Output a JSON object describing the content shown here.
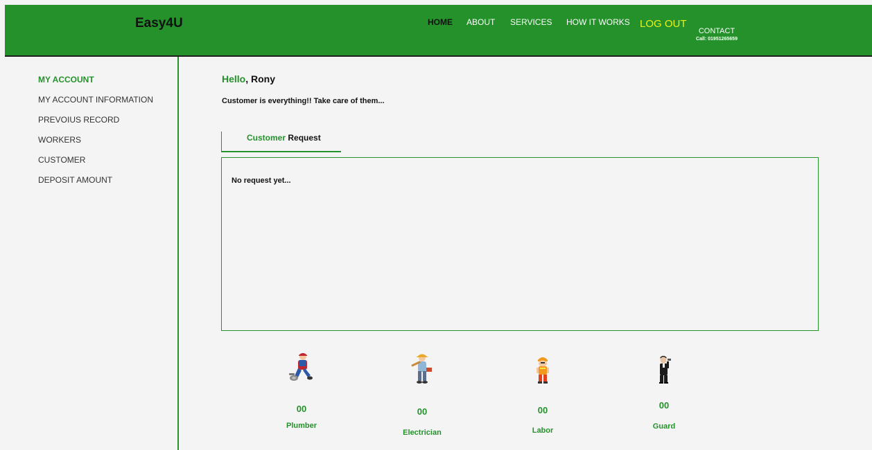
{
  "header": {
    "brand": "Easy4U",
    "nav": {
      "home": "HOME",
      "about": "ABOUT",
      "services": "SERVICES",
      "how_it_works": "HOW IT WORKS",
      "logout": "LOG OUT",
      "contact": "CONTACT",
      "contact_phone": "Call: 01951265659"
    }
  },
  "sidebar": {
    "items": [
      {
        "label": "MY ACCOUNT",
        "active": true
      },
      {
        "label": "MY ACCOUNT INFORMATION",
        "active": false
      },
      {
        "label": "PREVOIUS RECORD",
        "active": false
      },
      {
        "label": "WORKERS",
        "active": false
      },
      {
        "label": "CUSTOMER",
        "active": false
      },
      {
        "label": "DEPOSIT AMOUNT",
        "active": false
      }
    ]
  },
  "main": {
    "greeting": "Hello",
    "user_name": "Rony",
    "tagline": "Customer is everything!! Take care of them...",
    "tab": {
      "label_green": "Customer",
      "label_rest": "Request"
    },
    "empty_message": "No request yet..."
  },
  "workers": [
    {
      "icon": "plumber-icon",
      "count": "00",
      "label": "Plumber"
    },
    {
      "icon": "electrician-icon",
      "count": "00",
      "label": "Electrician"
    },
    {
      "icon": "labor-icon",
      "count": "00",
      "label": "Labor"
    },
    {
      "icon": "guard-icon",
      "count": "00",
      "label": "Guard"
    }
  ],
  "colors": {
    "brand_green": "#24912a",
    "logout_yellow": "#e8f21a",
    "background": "#f4f4f4"
  }
}
